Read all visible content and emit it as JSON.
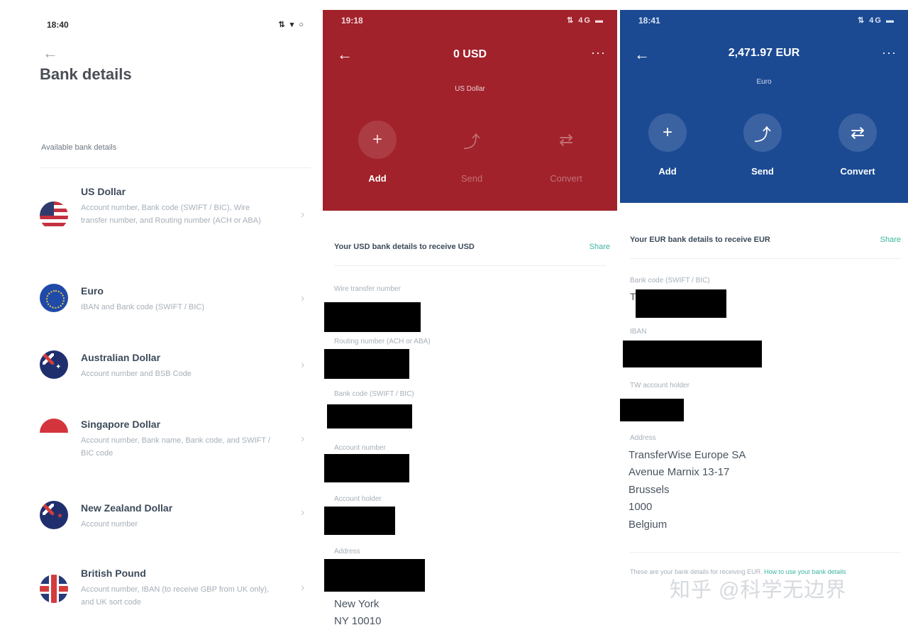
{
  "panel1": {
    "status_time": "18:40",
    "status_icons": "⇅ ▾ ○",
    "back_arrow": "←",
    "title": "Bank details",
    "section_label": "Available bank details",
    "currencies": [
      {
        "name": "US Dollar",
        "desc": "Account number, Bank code (SWIFT / BIC), Wire transfer number, and Routing number (ACH or ABA)",
        "flag_icon": "us-flag-icon"
      },
      {
        "name": "Euro",
        "desc": "IBAN and Bank code (SWIFT / BIC)",
        "flag_icon": "eu-flag-icon"
      },
      {
        "name": "Australian Dollar",
        "desc": "Account number and BSB Code",
        "flag_icon": "au-flag-icon"
      },
      {
        "name": "Singapore Dollar",
        "desc": "Account number, Bank name, Bank code, and SWIFT / BIC code",
        "flag_icon": "sg-flag-icon"
      },
      {
        "name": "New Zealand Dollar",
        "desc": "Account number",
        "flag_icon": "nz-flag-icon"
      },
      {
        "name": "British Pound",
        "desc": "Account number, IBAN (to receive GBP from UK only), and UK sort code",
        "flag_icon": "gb-flag-icon"
      }
    ],
    "chevron": "›"
  },
  "panel2": {
    "status_time": "19:18",
    "status_icons": "⇅ 4G ▬",
    "back_arrow": "←",
    "more": "···",
    "amount": "0 USD",
    "currency_sub": "US Dollar",
    "actions": [
      {
        "label": "Add",
        "icon": "plus-icon",
        "glyph": "+"
      },
      {
        "label": "Send",
        "icon": "send-icon",
        "glyph": "⤴"
      },
      {
        "label": "Convert",
        "icon": "convert-icon",
        "glyph": "⇄"
      }
    ],
    "share_title": "Your USD bank details to receive USD",
    "share_label": "Share",
    "fields": [
      "Wire transfer number",
      "Routing number (ACH or ABA)",
      "Bank code (SWIFT / BIC)",
      "Account number",
      "Account holder",
      "Address"
    ],
    "address_line": "New York",
    "address_line2": "NY 10010"
  },
  "panel3": {
    "status_time": "18:41",
    "status_icons": "⇅ 4G ▬",
    "back_arrow": "←",
    "more": "···",
    "amount": "2,471.97 EUR",
    "currency_sub": "Euro",
    "actions": [
      {
        "label": "Add",
        "icon": "plus-icon",
        "glyph": "+"
      },
      {
        "label": "Send",
        "icon": "send-icon",
        "glyph": "⤴"
      },
      {
        "label": "Convert",
        "icon": "convert-icon",
        "glyph": "⇄"
      }
    ],
    "share_title": "Your EUR bank details to receive EUR",
    "share_label": "Share",
    "fields": [
      "Bank code (SWIFT / BIC)",
      "IBAN",
      "TW account holder",
      "Address"
    ],
    "bank_code_prefix": "T",
    "address": [
      "TransferWise Europe SA",
      "Avenue Marnix 13-17",
      "Brussels",
      "1000",
      "Belgium"
    ],
    "footer_text": "These are your bank details for receiving EUR.",
    "footer_link": "How to use your bank details"
  },
  "watermark": "知乎 @科学无边界"
}
